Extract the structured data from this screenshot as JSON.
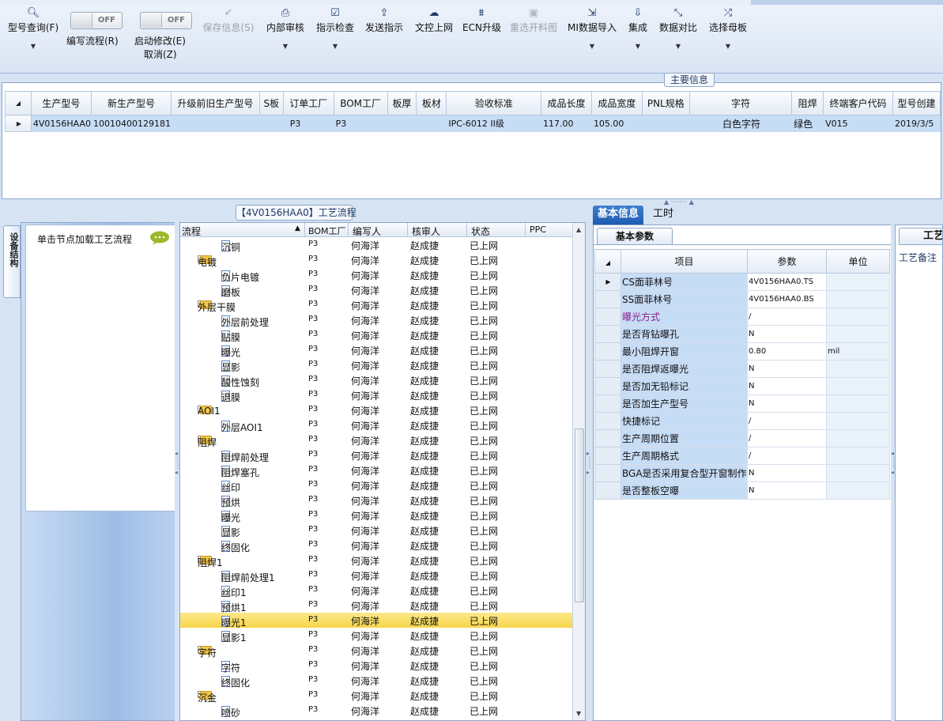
{
  "toolbar": {
    "buttons": [
      {
        "label": "型号查询(F)",
        "icon": "search-icon"
      },
      {
        "label": "保存信息(S)",
        "icon": "check-icon",
        "disabled": true
      },
      {
        "label": "内部审核",
        "icon": "printer-icon"
      },
      {
        "label": "指示检查",
        "icon": "checkbox-icon"
      },
      {
        "label": "发送指示",
        "icon": "upload-icon"
      },
      {
        "label": "文控上网",
        "icon": "cloud-upload-icon"
      },
      {
        "label": "ECN升级",
        "icon": "ecn-icon"
      },
      {
        "label": "重选开料图",
        "icon": "image-icon",
        "disabled": true
      },
      {
        "label": "MI数据导入",
        "icon": "import-icon"
      },
      {
        "label": "集成",
        "icon": "download-icon"
      },
      {
        "label": "数据对比",
        "icon": "compare-icon"
      },
      {
        "label": "选择母板",
        "icon": "shuffle-icon"
      }
    ],
    "toggle_write": {
      "state": "OFF",
      "label": "编写流程(R)"
    },
    "toggle_modify": {
      "state": "OFF",
      "label1": "启动修改(E)",
      "label2": "取消(Z)"
    }
  },
  "main_info": {
    "tab_label": "主要信息",
    "columns": [
      "生产型号",
      "新生产型号",
      "升级前旧生产型号",
      "S板",
      "订单工厂",
      "BOM工厂",
      "板厚",
      "板材",
      "验收标准",
      "成品长度",
      "成品宽度",
      "PNL规格",
      "字符",
      "阻焊",
      "终端客户代码",
      "型号创建"
    ],
    "row": [
      "4V0156HAA0",
      "10010400129181",
      "",
      "",
      "P3",
      "P3",
      "",
      "",
      "IPC-6012 II级",
      "117.00",
      "105.00",
      "",
      "白色字符",
      "绿色",
      "V015",
      "2019/3/5"
    ]
  },
  "left_panel": {
    "vertical_tab": "设备结构",
    "hint": "单击节点加载工艺流程"
  },
  "flow": {
    "title": "【4V0156HAA0】工艺流程",
    "columns": {
      "process": "流程",
      "bom_factory": "BOM工厂",
      "writer": "编写人",
      "reviewer": "核审人",
      "status": "状态",
      "ppc": "PPC"
    },
    "rows": [
      {
        "level": 2,
        "type": "doc",
        "name": "沉铜",
        "factory": "P3",
        "writer": "何海洋",
        "reviewer": "赵成捷",
        "status": "已上网"
      },
      {
        "level": 1,
        "type": "folder",
        "name": "电镀",
        "factory": "P3",
        "writer": "何海洋",
        "reviewer": "赵成捷",
        "status": "已上网"
      },
      {
        "level": 2,
        "type": "doc",
        "name": "负片电镀",
        "factory": "P3",
        "writer": "何海洋",
        "reviewer": "赵成捷",
        "status": "已上网"
      },
      {
        "level": 2,
        "type": "doc",
        "name": "磨板",
        "factory": "P3",
        "writer": "何海洋",
        "reviewer": "赵成捷",
        "status": "已上网"
      },
      {
        "level": 1,
        "type": "folder",
        "name": "外层干膜",
        "factory": "P3",
        "writer": "何海洋",
        "reviewer": "赵成捷",
        "status": "已上网"
      },
      {
        "level": 2,
        "type": "doc",
        "name": "外层前处理",
        "factory": "P3",
        "writer": "何海洋",
        "reviewer": "赵成捷",
        "status": "已上网"
      },
      {
        "level": 2,
        "type": "doc",
        "name": "贴膜",
        "factory": "P3",
        "writer": "何海洋",
        "reviewer": "赵成捷",
        "status": "已上网"
      },
      {
        "level": 2,
        "type": "doc",
        "name": "曝光",
        "factory": "P3",
        "writer": "何海洋",
        "reviewer": "赵成捷",
        "status": "已上网"
      },
      {
        "level": 2,
        "type": "doc",
        "name": "显影",
        "factory": "P3",
        "writer": "何海洋",
        "reviewer": "赵成捷",
        "status": "已上网"
      },
      {
        "level": 2,
        "type": "doc",
        "name": "酸性蚀刻",
        "factory": "P3",
        "writer": "何海洋",
        "reviewer": "赵成捷",
        "status": "已上网"
      },
      {
        "level": 2,
        "type": "doc",
        "name": "退膜",
        "factory": "P3",
        "writer": "何海洋",
        "reviewer": "赵成捷",
        "status": "已上网"
      },
      {
        "level": 1,
        "type": "folder",
        "name": "AOI1",
        "factory": "P3",
        "writer": "何海洋",
        "reviewer": "赵成捷",
        "status": "已上网"
      },
      {
        "level": 2,
        "type": "doc",
        "name": "外层AOI1",
        "factory": "P3",
        "writer": "何海洋",
        "reviewer": "赵成捷",
        "status": "已上网"
      },
      {
        "level": 1,
        "type": "folder",
        "name": "阻焊",
        "factory": "P3",
        "writer": "何海洋",
        "reviewer": "赵成捷",
        "status": "已上网"
      },
      {
        "level": 2,
        "type": "doc",
        "name": "阻焊前处理",
        "factory": "P3",
        "writer": "何海洋",
        "reviewer": "赵成捷",
        "status": "已上网"
      },
      {
        "level": 2,
        "type": "doc",
        "name": "阻焊塞孔",
        "factory": "P3",
        "writer": "何海洋",
        "reviewer": "赵成捷",
        "status": "已上网"
      },
      {
        "level": 2,
        "type": "doc",
        "name": "丝印",
        "factory": "P3",
        "writer": "何海洋",
        "reviewer": "赵成捷",
        "status": "已上网"
      },
      {
        "level": 2,
        "type": "doc",
        "name": "预烘",
        "factory": "P3",
        "writer": "何海洋",
        "reviewer": "赵成捷",
        "status": "已上网"
      },
      {
        "level": 2,
        "type": "doc",
        "name": "曝光",
        "factory": "P3",
        "writer": "何海洋",
        "reviewer": "赵成捷",
        "status": "已上网"
      },
      {
        "level": 2,
        "type": "doc",
        "name": "显影",
        "factory": "P3",
        "writer": "何海洋",
        "reviewer": "赵成捷",
        "status": "已上网"
      },
      {
        "level": 2,
        "type": "doc",
        "name": "终固化",
        "factory": "P3",
        "writer": "何海洋",
        "reviewer": "赵成捷",
        "status": "已上网"
      },
      {
        "level": 1,
        "type": "folder",
        "name": "阻焊1",
        "factory": "P3",
        "writer": "何海洋",
        "reviewer": "赵成捷",
        "status": "已上网"
      },
      {
        "level": 2,
        "type": "doc",
        "name": "阻焊前处理1",
        "factory": "P3",
        "writer": "何海洋",
        "reviewer": "赵成捷",
        "status": "已上网"
      },
      {
        "level": 2,
        "type": "doc",
        "name": "丝印1",
        "factory": "P3",
        "writer": "何海洋",
        "reviewer": "赵成捷",
        "status": "已上网"
      },
      {
        "level": 2,
        "type": "doc",
        "name": "预烘1",
        "factory": "P3",
        "writer": "何海洋",
        "reviewer": "赵成捷",
        "status": "已上网"
      },
      {
        "level": 2,
        "type": "doc",
        "name": "曝光1",
        "factory": "P3",
        "writer": "何海洋",
        "reviewer": "赵成捷",
        "status": "已上网",
        "selected": true
      },
      {
        "level": 2,
        "type": "doc",
        "name": "显影1",
        "factory": "P3",
        "writer": "何海洋",
        "reviewer": "赵成捷",
        "status": "已上网"
      },
      {
        "level": 1,
        "type": "folder",
        "name": "字符",
        "factory": "P3",
        "writer": "何海洋",
        "reviewer": "赵成捷",
        "status": "已上网"
      },
      {
        "level": 2,
        "type": "doc",
        "name": "字符",
        "factory": "P3",
        "writer": "何海洋",
        "reviewer": "赵成捷",
        "status": "已上网"
      },
      {
        "level": 2,
        "type": "doc",
        "name": "终固化",
        "factory": "P3",
        "writer": "何海洋",
        "reviewer": "赵成捷",
        "status": "已上网"
      },
      {
        "level": 1,
        "type": "folder",
        "name": "沉金",
        "factory": "P3",
        "writer": "何海洋",
        "reviewer": "赵成捷",
        "status": "已上网"
      },
      {
        "level": 2,
        "type": "doc",
        "name": "喷砂",
        "factory": "P3",
        "writer": "何海洋",
        "reviewer": "赵成捷",
        "status": "已上网"
      }
    ]
  },
  "right": {
    "tabs": [
      "基本信息",
      "工时"
    ],
    "subtab": "基本参数",
    "columns": {
      "item": "项目",
      "param": "参数",
      "unit": "单位"
    },
    "rows": [
      {
        "item": "CS面菲林号",
        "param": "4V0156HAA0.TS",
        "unit": "",
        "selected": true
      },
      {
        "item": "SS面菲林号",
        "param": "4V0156HAA0.BS",
        "unit": ""
      },
      {
        "item": "曝光方式",
        "param": "/",
        "unit": "",
        "highlight": true
      },
      {
        "item": "是否背钻曝孔",
        "param": "N",
        "unit": ""
      },
      {
        "item": "最小阻焊开窗",
        "param": "0.80",
        "unit": "mil"
      },
      {
        "item": "是否阻焊返曝光",
        "param": "N",
        "unit": ""
      },
      {
        "item": "是否加无铅标记",
        "param": "N",
        "unit": ""
      },
      {
        "item": "是否加生产型号",
        "param": "N",
        "unit": ""
      },
      {
        "item": "快捷标记",
        "param": "/",
        "unit": ""
      },
      {
        "item": "生产周期位置",
        "param": "/",
        "unit": ""
      },
      {
        "item": "生产周期格式",
        "param": "/",
        "unit": ""
      },
      {
        "item": "BGA是否采用复合型开窗制作",
        "param": "N",
        "unit": ""
      },
      {
        "item": "是否整板空曝",
        "param": "N",
        "unit": ""
      }
    ],
    "notes_tab": "工艺",
    "notes_label": "工艺备注"
  }
}
